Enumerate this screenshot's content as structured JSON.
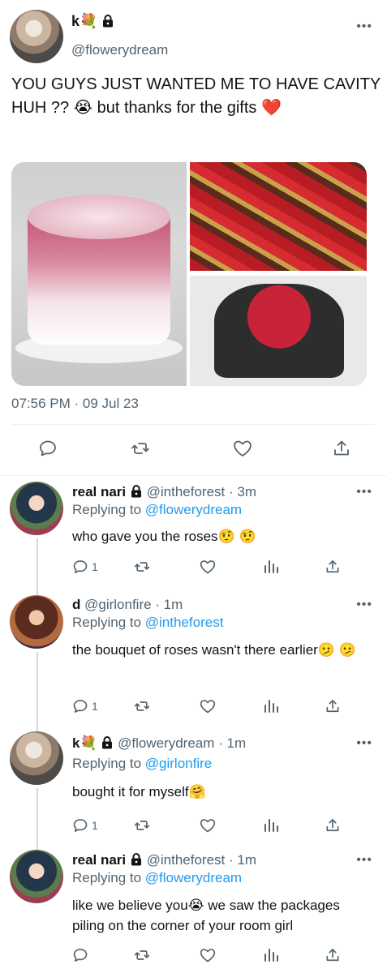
{
  "main_tweet": {
    "display_name": "k💐",
    "handle": "@flowerydream",
    "text": "YOU GUYS JUST WANTED ME TO HAVE CAVITY HUH ?? 😭  but thanks for the gifts ❤️",
    "time": "07:56 PM · 09 Jul 23",
    "more": "•••"
  },
  "replies": [
    {
      "display_name": "real nari",
      "handle": "@intheforest · 3m",
      "replying_prefix": "Replying to ",
      "replying_to": "@flowerydream",
      "text": "who gave you the roses🤨 🤨",
      "reply_count": "1",
      "more": "•••"
    },
    {
      "display_name": "d",
      "handle": "@girlonfire · 1m",
      "replying_prefix": "Replying to ",
      "replying_to": "@intheforest",
      "text": "the bouquet of roses wasn't there earlier🫤 🫤",
      "reply_count": "1",
      "more": "•••"
    },
    {
      "display_name": "k💐",
      "handle": "@flowerydream · 1m",
      "replying_prefix": "Replying to ",
      "replying_to": "@girlonfire",
      "text": "bought it for myself🤗",
      "reply_count": "1",
      "more": "•••"
    },
    {
      "display_name": "real nari",
      "handle": "@intheforest · 1m",
      "replying_prefix": "Replying to ",
      "replying_to": "@flowerydream",
      "text": "like we believe you😭  we saw the packages piling on the corner of your room girl",
      "reply_count": "",
      "more": "•••"
    }
  ],
  "icons": [
    "reply-icon",
    "retweet-icon",
    "like-icon",
    "share-icon",
    "analytics-icon",
    "lock-icon",
    "more-icon"
  ],
  "colors": {
    "link": "#1d9bf0",
    "secondary_text": "#536471",
    "divider": "#eff3f4"
  }
}
